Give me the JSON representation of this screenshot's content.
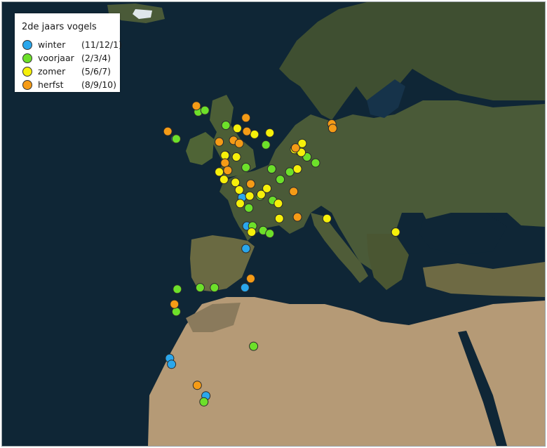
{
  "legend": {
    "title": "2de jaars vogels",
    "items": [
      {
        "label": "winter",
        "months": "(11/12/1)",
        "color": "#2aa7ec"
      },
      {
        "label": "voorjaar",
        "months": "(2/3/4)",
        "color": "#6de02a"
      },
      {
        "label": "zomer",
        "months": "(5/6/7)",
        "color": "#f6f00a"
      },
      {
        "label": "herfst",
        "months": "(8/9/10)",
        "color": "#f59b16"
      }
    ]
  },
  "colors": {
    "sea": "#0f2636",
    "land_green": "#4a5a38",
    "land_dark": "#34412a",
    "desert": "#b59a76",
    "ice": "#dfe6ea",
    "marker_border": "#2b2b2b"
  },
  "observations": [
    {
      "season": 0,
      "lon": -8.6,
      "lat": 53.3
    },
    {
      "season": 0,
      "lon": -3.3,
      "lat": 52.2
    },
    {
      "season": 0,
      "lon": -1.6,
      "lat": 49.4
    },
    {
      "season": 0,
      "lon": -1.1,
      "lat": 47.5
    },
    {
      "season": 0,
      "lon": -1.2,
      "lat": 46.0
    },
    {
      "season": 0,
      "lon": -1.3,
      "lat": 43.4
    },
    {
      "season": 0,
      "lon": -9.2,
      "lat": 38.7
    },
    {
      "season": 0,
      "lon": -9.0,
      "lat": 38.3
    },
    {
      "season": 0,
      "lon": -5.4,
      "lat": 36.2
    },
    {
      "season": 1,
      "lon": -6.2,
      "lat": 55.1
    },
    {
      "season": 1,
      "lon": -5.5,
      "lat": 55.2
    },
    {
      "season": 1,
      "lon": -8.5,
      "lat": 53.3
    },
    {
      "season": 1,
      "lon": -3.3,
      "lat": 54.2
    },
    {
      "season": 1,
      "lon": 0.9,
      "lat": 52.9
    },
    {
      "season": 1,
      "lon": 4.4,
      "lat": 52.5
    },
    {
      "season": 1,
      "lon": 5.2,
      "lat": 52.1
    },
    {
      "season": 1,
      "lon": 6.1,
      "lat": 51.7
    },
    {
      "season": 1,
      "lon": 3.4,
      "lat": 51.1
    },
    {
      "season": 1,
      "lon": -1.2,
      "lat": 51.4
    },
    {
      "season": 1,
      "lon": 1.5,
      "lat": 51.3
    },
    {
      "season": 1,
      "lon": 2.4,
      "lat": 50.6
    },
    {
      "season": 1,
      "lon": 0.3,
      "lat": 49.5
    },
    {
      "season": 1,
      "lon": 1.6,
      "lat": 49.2
    },
    {
      "season": 1,
      "lon": -0.9,
      "lat": 48.7
    },
    {
      "season": 1,
      "lon": -0.5,
      "lat": 47.5
    },
    {
      "season": 1,
      "lon": 0.6,
      "lat": 47.2
    },
    {
      "season": 1,
      "lon": 1.3,
      "lat": 47.0
    },
    {
      "season": 1,
      "lon": -8.4,
      "lat": 43.3
    },
    {
      "season": 1,
      "lon": -6.0,
      "lat": 43.4
    },
    {
      "season": 1,
      "lon": -4.5,
      "lat": 43.4
    },
    {
      "season": 1,
      "lon": -8.7,
      "lat": 42.3
    },
    {
      "season": 1,
      "lon": -8.5,
      "lat": 41.8
    },
    {
      "season": 1,
      "lon": -0.4,
      "lat": 39.5
    },
    {
      "season": 1,
      "lon": -5.6,
      "lat": 35.8
    },
    {
      "season": 2,
      "lon": -2.1,
      "lat": 54.0
    },
    {
      "season": 2,
      "lon": -0.3,
      "lat": 53.6
    },
    {
      "season": 2,
      "lon": 1.3,
      "lat": 53.7
    },
    {
      "season": 2,
      "lon": 4.7,
      "lat": 53.0
    },
    {
      "season": 2,
      "lon": 3.9,
      "lat": 52.6
    },
    {
      "season": 2,
      "lon": 4.6,
      "lat": 52.4
    },
    {
      "season": 2,
      "lon": -3.4,
      "lat": 52.2
    },
    {
      "season": 2,
      "lon": -2.2,
      "lat": 52.1
    },
    {
      "season": 2,
      "lon": -4.0,
      "lat": 51.1
    },
    {
      "season": 2,
      "lon": -3.5,
      "lat": 50.6
    },
    {
      "season": 2,
      "lon": -2.3,
      "lat": 50.4
    },
    {
      "season": 2,
      "lon": -1.9,
      "lat": 49.9
    },
    {
      "season": 2,
      "lon": -0.8,
      "lat": 49.5
    },
    {
      "season": 2,
      "lon": 0.4,
      "lat": 49.6
    },
    {
      "season": 2,
      "lon": 1.0,
      "lat": 50.0
    },
    {
      "season": 2,
      "lon": 2.2,
      "lat": 49.0
    },
    {
      "season": 2,
      "lon": -1.8,
      "lat": 49.0
    },
    {
      "season": 2,
      "lon": -0.6,
      "lat": 47.1
    },
    {
      "season": 2,
      "lon": 2.3,
      "lat": 48.0
    },
    {
      "season": 2,
      "lon": 4.2,
      "lat": 51.3
    },
    {
      "season": 2,
      "lon": 7.3,
      "lat": 48.0
    },
    {
      "season": 2,
      "lon": 14.5,
      "lat": 47.1
    },
    {
      "season": 3,
      "lon": -6.4,
      "lat": 55.5
    },
    {
      "season": 3,
      "lon": -1.2,
      "lat": 54.7
    },
    {
      "season": 3,
      "lon": -1.1,
      "lat": 53.8
    },
    {
      "season": 3,
      "lon": -4.0,
      "lat": 53.1
    },
    {
      "season": 3,
      "lon": -2.5,
      "lat": 53.2
    },
    {
      "season": 3,
      "lon": -1.9,
      "lat": 53.0
    },
    {
      "season": 3,
      "lon": -9.4,
      "lat": 53.8
    },
    {
      "season": 3,
      "lon": 7.8,
      "lat": 54.3
    },
    {
      "season": 3,
      "lon": 7.9,
      "lat": 54.0
    },
    {
      "season": 3,
      "lon": 4.0,
      "lat": 52.7
    },
    {
      "season": 3,
      "lon": -3.4,
      "lat": 51.7
    },
    {
      "season": 3,
      "lon": -3.1,
      "lat": 51.2
    },
    {
      "season": 3,
      "lon": -0.7,
      "lat": 50.3
    },
    {
      "season": 3,
      "lon": 3.8,
      "lat": 49.8
    },
    {
      "season": 3,
      "lon": 4.2,
      "lat": 48.1
    },
    {
      "season": 3,
      "lon": -0.7,
      "lat": 44.0
    },
    {
      "season": 3,
      "lon": -8.7,
      "lat": 42.3
    },
    {
      "season": 3,
      "lon": -6.3,
      "lat": 36.9
    }
  ]
}
